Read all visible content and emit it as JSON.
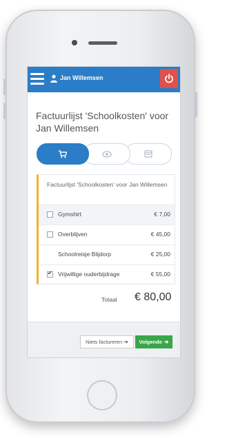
{
  "header": {
    "user_name": "Jan Willemsen",
    "menu_icon": "hamburger-icon",
    "user_icon": "user-icon",
    "power_icon": "power-icon"
  },
  "page": {
    "title": "Factuurlijst 'Schoolkosten' voor Jan Willemsen"
  },
  "stepper": {
    "steps": [
      {
        "icon": "cart-icon",
        "active": true
      },
      {
        "icon": "eye-icon",
        "active": false
      },
      {
        "icon": "invoice-icon",
        "active": false
      }
    ]
  },
  "invoice": {
    "heading": "Factuurlijst 'Schoolkosten' voor Jan Willemsen",
    "items": [
      {
        "label": "Gymshirt",
        "price": "€ 7,00",
        "checkbox": true,
        "checked": false
      },
      {
        "label": "Overblijven",
        "price": "€ 45,00",
        "checkbox": true,
        "checked": false
      },
      {
        "label": "Schoolreisje Blijdorp",
        "price": "€ 25,00",
        "checkbox": false,
        "checked": false
      },
      {
        "label": "Vrijwillige ouderbijdrage",
        "price": "€ 55,00",
        "checkbox": true,
        "checked": true
      }
    ],
    "total_label": "Totaal",
    "total_value": "€ 80,00"
  },
  "footer": {
    "skip_label": "Niets factureren",
    "next_label": "Volgende"
  },
  "colors": {
    "primary": "#2a7dc6",
    "danger": "#e05149",
    "success": "#3aa64a",
    "accent": "#f0b429"
  }
}
